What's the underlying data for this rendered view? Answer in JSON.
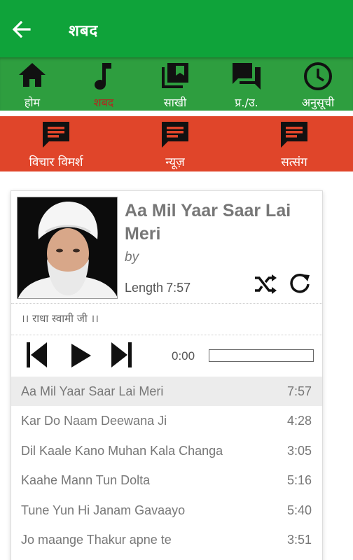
{
  "appbar": {
    "title": "शबद"
  },
  "nav_primary": [
    {
      "label": "होम",
      "icon": "home-icon"
    },
    {
      "label": "शबद",
      "icon": "music-note-icon",
      "active": true
    },
    {
      "label": "साखी",
      "icon": "library-icon"
    },
    {
      "label": "प्र./उ.",
      "icon": "forum-icon"
    },
    {
      "label": "अनुसूची",
      "icon": "clock-icon"
    }
  ],
  "nav_secondary": [
    {
      "label": "विचार विमर्श",
      "icon": "chat-icon"
    },
    {
      "label": "न्यूज़",
      "icon": "chat-icon"
    },
    {
      "label": "सत्संग",
      "icon": "chat-icon"
    }
  ],
  "now_playing": {
    "title": "Aa Mil Yaar Saar Lai Meri",
    "by": "by",
    "length_label": "Length",
    "length_value": "7:57",
    "subtitle": "।। राधा स्वामी जी ।।"
  },
  "player": {
    "time": "0:00",
    "progress": 0
  },
  "tracks": [
    {
      "name": "Aa Mil Yaar Saar Lai Meri",
      "duration": "7:57",
      "selected": true
    },
    {
      "name": "Kar Do Naam Deewana Ji",
      "duration": "4:28"
    },
    {
      "name": "Dil Kaale Kano Muhan Kala Changa",
      "duration": "3:05"
    },
    {
      "name": "Kaahe Mann Tun Dolta",
      "duration": "5:16"
    },
    {
      "name": "Tune Yun Hi Janam Gavaayo",
      "duration": "5:40"
    },
    {
      "name": "Jo maange Thakur apne te",
      "duration": "3:51"
    }
  ],
  "colors": {
    "appbar": "#0fa33a",
    "nav_primary": "#2e9e3f",
    "nav_secondary": "#e0452a",
    "active_label": "#b3261e"
  }
}
